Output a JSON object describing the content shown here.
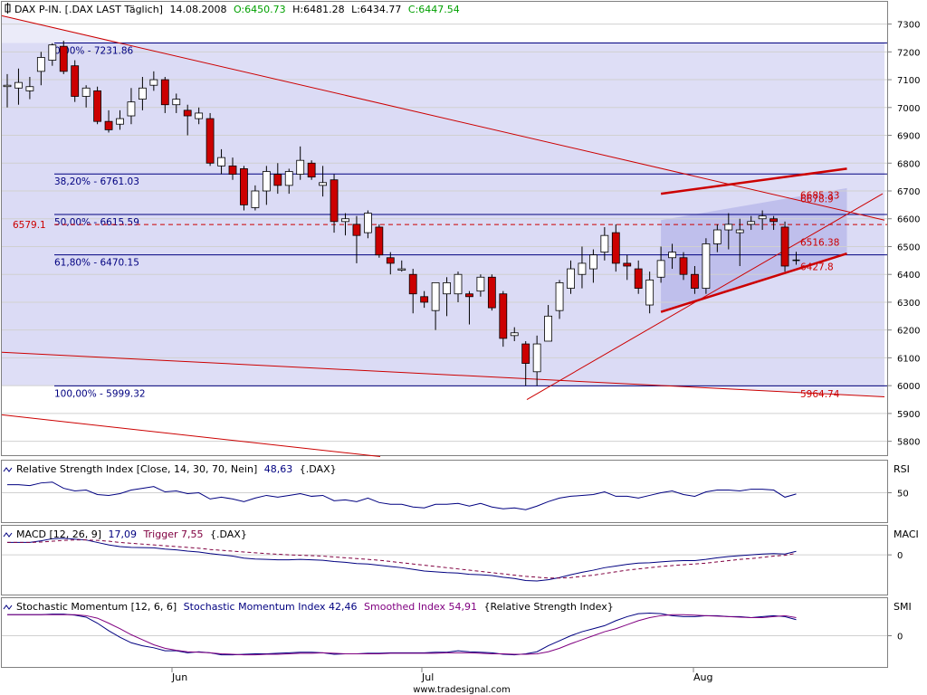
{
  "header": {
    "symbol_text": "DAX P-IN. [.DAX LAST Täglich]",
    "date": "14.08.2008",
    "open_text": "O:6450.73",
    "high_text": "H:6481.28",
    "low_text": "L:6434.77",
    "close_text": "C:6447.54",
    "open_color": "#00a000",
    "close_color": "#00a000"
  },
  "footer": {
    "credit": "www.tradesignal.com"
  },
  "colors": {
    "up_body": "#ffffff",
    "down_body": "#cc0000",
    "fib_line": "#000080",
    "trend_line": "#cc0000",
    "shade": "#d8d8f4",
    "channel_shade": "#b8b8ea",
    "rsi_line": "#000080",
    "macd_line": "#000080",
    "trigger_line": "#800040",
    "smi_line": "#000080",
    "smoothed_line": "#800080"
  },
  "chart_data": [
    {
      "type": "candlestick",
      "panel": "price",
      "x_ticks": [
        "Jun",
        "Jul",
        "Aug"
      ],
      "ylim": [
        5750,
        7380
      ],
      "y_ticks": [
        5800,
        5900,
        6000,
        6100,
        6200,
        6300,
        6400,
        6500,
        6600,
        6700,
        6800,
        6900,
        7000,
        7100,
        7200,
        7300
      ],
      "grid": true,
      "candles": [
        {
          "o": 7080,
          "h": 7120,
          "l": 7000,
          "c": 7080
        },
        {
          "o": 7070,
          "h": 7140,
          "l": 7010,
          "c": 7090
        },
        {
          "o": 7060,
          "h": 7110,
          "l": 7030,
          "c": 7075
        },
        {
          "o": 7130,
          "h": 7200,
          "l": 7080,
          "c": 7180
        },
        {
          "o": 7170,
          "h": 7231,
          "l": 7150,
          "c": 7225
        },
        {
          "o": 7220,
          "h": 7240,
          "l": 7120,
          "c": 7130
        },
        {
          "o": 7150,
          "h": 7170,
          "l": 7020,
          "c": 7040
        },
        {
          "o": 7040,
          "h": 7080,
          "l": 7000,
          "c": 7070
        },
        {
          "o": 7060,
          "h": 7075,
          "l": 6940,
          "c": 6950
        },
        {
          "o": 6950,
          "h": 6990,
          "l": 6910,
          "c": 6920
        },
        {
          "o": 6940,
          "h": 6990,
          "l": 6920,
          "c": 6960
        },
        {
          "o": 6970,
          "h": 7070,
          "l": 6940,
          "c": 7020
        },
        {
          "o": 7030,
          "h": 7110,
          "l": 6990,
          "c": 7070
        },
        {
          "o": 7080,
          "h": 7130,
          "l": 7060,
          "c": 7100
        },
        {
          "o": 7100,
          "h": 7110,
          "l": 6980,
          "c": 7010
        },
        {
          "o": 7010,
          "h": 7050,
          "l": 6980,
          "c": 7030
        },
        {
          "o": 6990,
          "h": 7010,
          "l": 6900,
          "c": 6970
        },
        {
          "o": 6960,
          "h": 7000,
          "l": 6940,
          "c": 6980
        },
        {
          "o": 6960,
          "h": 6980,
          "l": 6790,
          "c": 6800
        },
        {
          "o": 6790,
          "h": 6850,
          "l": 6760,
          "c": 6820
        },
        {
          "o": 6790,
          "h": 6820,
          "l": 6740,
          "c": 6760
        },
        {
          "o": 6780,
          "h": 6790,
          "l": 6630,
          "c": 6650
        },
        {
          "o": 6640,
          "h": 6720,
          "l": 6630,
          "c": 6700
        },
        {
          "o": 6700,
          "h": 6790,
          "l": 6650,
          "c": 6770
        },
        {
          "o": 6760,
          "h": 6800,
          "l": 6690,
          "c": 6720
        },
        {
          "o": 6720,
          "h": 6780,
          "l": 6690,
          "c": 6770
        },
        {
          "o": 6760,
          "h": 6860,
          "l": 6740,
          "c": 6810
        },
        {
          "o": 6800,
          "h": 6810,
          "l": 6740,
          "c": 6750
        },
        {
          "o": 6720,
          "h": 6790,
          "l": 6680,
          "c": 6730
        },
        {
          "o": 6740,
          "h": 6760,
          "l": 6550,
          "c": 6590
        },
        {
          "o": 6590,
          "h": 6620,
          "l": 6540,
          "c": 6600
        },
        {
          "o": 6580,
          "h": 6610,
          "l": 6440,
          "c": 6540
        },
        {
          "o": 6550,
          "h": 6630,
          "l": 6530,
          "c": 6620
        },
        {
          "o": 6570,
          "h": 6580,
          "l": 6460,
          "c": 6470
        },
        {
          "o": 6460,
          "h": 6480,
          "l": 6400,
          "c": 6440
        },
        {
          "o": 6420,
          "h": 6450,
          "l": 6410,
          "c": 6420
        },
        {
          "o": 6400,
          "h": 6420,
          "l": 6260,
          "c": 6330
        },
        {
          "o": 6320,
          "h": 6340,
          "l": 6280,
          "c": 6300
        },
        {
          "o": 6270,
          "h": 6340,
          "l": 6200,
          "c": 6370
        },
        {
          "o": 6330,
          "h": 6390,
          "l": 6250,
          "c": 6370
        },
        {
          "o": 6330,
          "h": 6410,
          "l": 6300,
          "c": 6400
        },
        {
          "o": 6330,
          "h": 6340,
          "l": 6220,
          "c": 6320
        },
        {
          "o": 6340,
          "h": 6400,
          "l": 6320,
          "c": 6390
        },
        {
          "o": 6390,
          "h": 6400,
          "l": 6270,
          "c": 6280
        },
        {
          "o": 6330,
          "h": 6340,
          "l": 6140,
          "c": 6170
        },
        {
          "o": 6180,
          "h": 6210,
          "l": 6160,
          "c": 6190
        },
        {
          "o": 6150,
          "h": 6160,
          "l": 6000,
          "c": 6080
        },
        {
          "o": 6050,
          "h": 6180,
          "l": 6000,
          "c": 6150
        },
        {
          "o": 6160,
          "h": 6290,
          "l": 6160,
          "c": 6250
        },
        {
          "o": 6270,
          "h": 6380,
          "l": 6240,
          "c": 6370
        },
        {
          "o": 6350,
          "h": 6450,
          "l": 6330,
          "c": 6420
        },
        {
          "o": 6400,
          "h": 6500,
          "l": 6350,
          "c": 6440
        },
        {
          "o": 6420,
          "h": 6490,
          "l": 6370,
          "c": 6470
        },
        {
          "o": 6480,
          "h": 6570,
          "l": 6450,
          "c": 6540
        },
        {
          "o": 6550,
          "h": 6580,
          "l": 6410,
          "c": 6440
        },
        {
          "o": 6440,
          "h": 6470,
          "l": 6380,
          "c": 6430
        },
        {
          "o": 6420,
          "h": 6450,
          "l": 6330,
          "c": 6350
        },
        {
          "o": 6290,
          "h": 6410,
          "l": 6260,
          "c": 6380
        },
        {
          "o": 6390,
          "h": 6500,
          "l": 6370,
          "c": 6450
        },
        {
          "o": 6460,
          "h": 6510,
          "l": 6420,
          "c": 6480
        },
        {
          "o": 6460,
          "h": 6480,
          "l": 6380,
          "c": 6400
        },
        {
          "o": 6400,
          "h": 6430,
          "l": 6330,
          "c": 6350
        },
        {
          "o": 6350,
          "h": 6530,
          "l": 6330,
          "c": 6510
        },
        {
          "o": 6510,
          "h": 6580,
          "l": 6480,
          "c": 6560
        },
        {
          "o": 6560,
          "h": 6620,
          "l": 6490,
          "c": 6580
        },
        {
          "o": 6550,
          "h": 6600,
          "l": 6430,
          "c": 6560
        },
        {
          "o": 6580,
          "h": 6610,
          "l": 6560,
          "c": 6590
        },
        {
          "o": 6600,
          "h": 6630,
          "l": 6560,
          "c": 6610
        },
        {
          "o": 6600,
          "h": 6610,
          "l": 6560,
          "c": 6590
        },
        {
          "o": 6570,
          "h": 6590,
          "l": 6410,
          "c": 6430
        },
        {
          "o": 6450.73,
          "h": 6481.28,
          "l": 6434.77,
          "c": 6447.54
        }
      ],
      "annotations": {
        "fib_levels": [
          {
            "label": "0,00% - 7231.86",
            "value": 7231.86
          },
          {
            "label": "38,20% - 6761.03",
            "value": 6761.03
          },
          {
            "label": "50,00% - 6615.59",
            "value": 6615.59
          },
          {
            "label": "61,80% - 6470.15",
            "value": 6470.15
          },
          {
            "label": "100,00% - 5999.32",
            "value": 5999.32
          }
        ],
        "left_level": {
          "label": "6579.1",
          "value": 6579.1
        },
        "channel_labels": [
          {
            "label": "6685.33",
            "value": 6685.33
          },
          {
            "label": "6678.9",
            "value": 6678.9
          },
          {
            "label": "6516.38",
            "value": 6516.38
          },
          {
            "label": "6427.8",
            "value": 6427.8
          }
        ],
        "lower_label": {
          "label": "5964.74",
          "value": 5964.74
        }
      }
    },
    {
      "type": "line",
      "panel": "rsi",
      "title": "Relative Strength Index [Close, 14, 30, 70, Nein]",
      "value_text": "48,63",
      "symbol_text": "{.DAX}",
      "axis_label": "RSI",
      "y_ticks": [
        50
      ],
      "ylim": [
        20,
        80
      ],
      "series": [
        {
          "name": "Relative Strength Index",
          "values": [
            59,
            59,
            58,
            61,
            62,
            55,
            52,
            53,
            48,
            47,
            49,
            53,
            55,
            57,
            51,
            52,
            49,
            50,
            43,
            45,
            43,
            40,
            44,
            47,
            45,
            47,
            49,
            46,
            47,
            41,
            42,
            40,
            44,
            39,
            37,
            37,
            34,
            33,
            37,
            37,
            38,
            35,
            38,
            34,
            32,
            33,
            31,
            35,
            40,
            44,
            46,
            47,
            48,
            51,
            46,
            46,
            44,
            47,
            50,
            52,
            48,
            46,
            51,
            53,
            53,
            52,
            54,
            54,
            53,
            45,
            48.63
          ]
        }
      ]
    },
    {
      "type": "line",
      "panel": "macd",
      "title": "MACD [12, 26, 9]",
      "value_text": "17,09",
      "trigger_text": "Trigger 7,55",
      "symbol_text": "{.DAX}",
      "axis_label": "MACI",
      "y_ticks": [
        0
      ],
      "ylim": [
        -170,
        110
      ],
      "series": [
        {
          "name": "MACD",
          "values": [
            60,
            60,
            60,
            68,
            78,
            80,
            76,
            72,
            60,
            48,
            40,
            36,
            35,
            34,
            28,
            24,
            18,
            14,
            6,
            0,
            -6,
            -16,
            -20,
            -22,
            -24,
            -24,
            -22,
            -24,
            -26,
            -32,
            -36,
            -42,
            -44,
            -50,
            -56,
            -62,
            -70,
            -78,
            -82,
            -86,
            -88,
            -94,
            -96,
            -100,
            -108,
            -114,
            -124,
            -126,
            -120,
            -110,
            -96,
            -84,
            -74,
            -62,
            -54,
            -46,
            -40,
            -38,
            -34,
            -30,
            -28,
            -28,
            -22,
            -14,
            -8,
            -4,
            0,
            4,
            6,
            4,
            17.09
          ]
        },
        {
          "name": "Trigger",
          "values": [
            60,
            60,
            60,
            62,
            66,
            70,
            72,
            72,
            70,
            66,
            60,
            56,
            52,
            48,
            44,
            40,
            36,
            32,
            26,
            22,
            18,
            14,
            10,
            6,
            3,
            0,
            -2,
            -4,
            -6,
            -10,
            -14,
            -18,
            -22,
            -26,
            -32,
            -38,
            -44,
            -50,
            -56,
            -62,
            -68,
            -74,
            -80,
            -86,
            -92,
            -98,
            -104,
            -108,
            -112,
            -112,
            -110,
            -104,
            -98,
            -90,
            -82,
            -74,
            -68,
            -62,
            -56,
            -52,
            -48,
            -44,
            -40,
            -34,
            -28,
            -22,
            -18,
            -12,
            -6,
            -2,
            7.55
          ]
        }
      ]
    },
    {
      "type": "line",
      "panel": "smi",
      "title": "Stochastic Momentum [12, 6, 6]",
      "series_1_label": "Stochastic Momentum Index 42,46",
      "series_2_label": "Smoothed Index 54,91",
      "extra_text": "{Relative Strength Index}",
      "axis_label": "SMI",
      "y_ticks": [
        0
      ],
      "ylim": [
        -55,
        55
      ],
      "series": [
        {
          "name": "Stochastic Momentum Index",
          "values": [
            42,
            42,
            42,
            42,
            43,
            43,
            41,
            37,
            25,
            10,
            -3,
            -14,
            -20,
            -24,
            -30,
            -30,
            -34,
            -32,
            -34,
            -38,
            -38,
            -37,
            -36,
            -36,
            -35,
            -34,
            -33,
            -33,
            -34,
            -37,
            -36,
            -36,
            -35,
            -35,
            -34,
            -34,
            -34,
            -34,
            -33,
            -33,
            -30,
            -32,
            -33,
            -34,
            -37,
            -38,
            -36,
            -32,
            -20,
            -10,
            0,
            8,
            14,
            20,
            30,
            38,
            44,
            45,
            44,
            40,
            38,
            38,
            40,
            40,
            38,
            38,
            36,
            38,
            40,
            38,
            32
          ]
        },
        {
          "name": "Smoothed Index",
          "values": [
            42,
            42,
            42,
            42,
            42,
            42,
            42,
            40,
            35,
            25,
            14,
            2,
            -8,
            -18,
            -25,
            -29,
            -32,
            -33,
            -34,
            -36,
            -37,
            -38,
            -38,
            -37,
            -37,
            -36,
            -35,
            -35,
            -34,
            -35,
            -36,
            -36,
            -36,
            -36,
            -35,
            -35,
            -35,
            -35,
            -35,
            -34,
            -34,
            -34,
            -35,
            -36,
            -36,
            -37,
            -37,
            -36,
            -32,
            -25,
            -16,
            -8,
            0,
            8,
            14,
            22,
            30,
            36,
            40,
            42,
            42,
            41,
            40,
            39,
            38,
            37,
            36,
            36,
            38,
            40,
            36
          ]
        }
      ]
    }
  ]
}
